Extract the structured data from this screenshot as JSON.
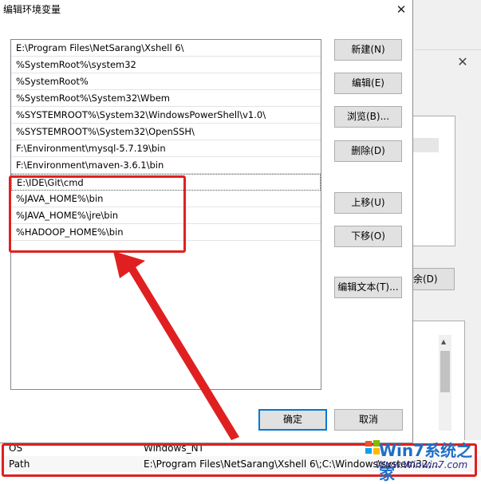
{
  "dialog": {
    "title": "编辑环境变量",
    "close_glyph": "✕",
    "path_entries": [
      "E:\\Program Files\\NetSarang\\Xshell 6\\",
      "%SystemRoot%\\system32",
      "%SystemRoot%",
      "%SystemRoot%\\System32\\Wbem",
      "%SYSTEMROOT%\\System32\\WindowsPowerShell\\v1.0\\",
      "%SYSTEMROOT%\\System32\\OpenSSH\\",
      "F:\\Environment\\mysql-5.7.19\\bin",
      "F:\\Environment\\maven-3.6.1\\bin",
      "E:\\IDE\\Git\\cmd",
      "%JAVA_HOME%\\bin",
      "%JAVA_HOME%\\jre\\bin",
      "%HADOOP_HOME%\\bin"
    ],
    "buttons": {
      "new": "新建(N)",
      "edit": "编辑(E)",
      "browse": "浏览(B)...",
      "delete": "删除(D)",
      "move_up": "上移(U)",
      "move_down": "下移(O)",
      "edit_text": "编辑文本(T)...",
      "ok": "确定",
      "cancel": "取消"
    }
  },
  "background_window": {
    "close_glyph": "✕",
    "delete_button_partial": "余(D)",
    "variables": [
      {
        "name": "OS",
        "value": "Windows_NT"
      },
      {
        "name": "Path",
        "value": "E:\\Program Files\\NetSarang\\Xshell 6\\;C:\\Windows\\system32;..."
      }
    ]
  },
  "watermark": {
    "brand": "Win7系统之家",
    "url": "Www.Winwin7.com"
  },
  "colors": {
    "highlight_red": "#e02020",
    "ok_border": "#0078d7",
    "watermark_blue": "#1e6fc9"
  }
}
